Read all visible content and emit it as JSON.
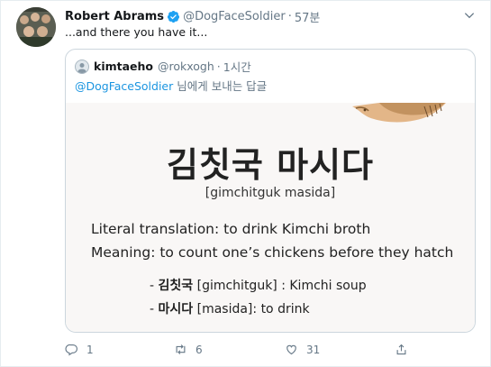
{
  "tweet": {
    "author_name": "Robert Abrams",
    "handle": "@DogFaceSoldier",
    "separator": "·",
    "time": "57분",
    "text": "...and there you have it..."
  },
  "quote": {
    "author_name": "kimtaeho",
    "handle": "@rokxogh",
    "separator": "·",
    "time": "1시간",
    "reply_to_mention": "@DogFaceSoldier",
    "reply_to_suffix": " 님에게 보내는 답글",
    "image": {
      "korean_title": "김칫국 마시다",
      "romanization": "[gimchitguk masida]",
      "literal_label": "Literal translation",
      "literal_value": ": to drink Kimchi broth",
      "meaning_label": "Meaning",
      "meaning_value": ": to count one’s chickens before they hatch",
      "bullet1_prefix": "- ",
      "bullet1_word": "김칫국",
      "bullet1_rest": " [gimchitguk] : Kimchi soup",
      "bullet2_prefix": "- ",
      "bullet2_word": "마시다",
      "bullet2_rest": " [masida]: to drink"
    }
  },
  "actions": {
    "reply_count": "1",
    "retweet_count": "6",
    "like_count": "31"
  },
  "colors": {
    "verified": "#1da1f2",
    "link": "#1b95e0",
    "muted": "#657786"
  },
  "icons": [
    "verified-badge-icon",
    "chevron-down-icon",
    "reply-icon",
    "retweet-icon",
    "like-icon",
    "share-icon"
  ]
}
